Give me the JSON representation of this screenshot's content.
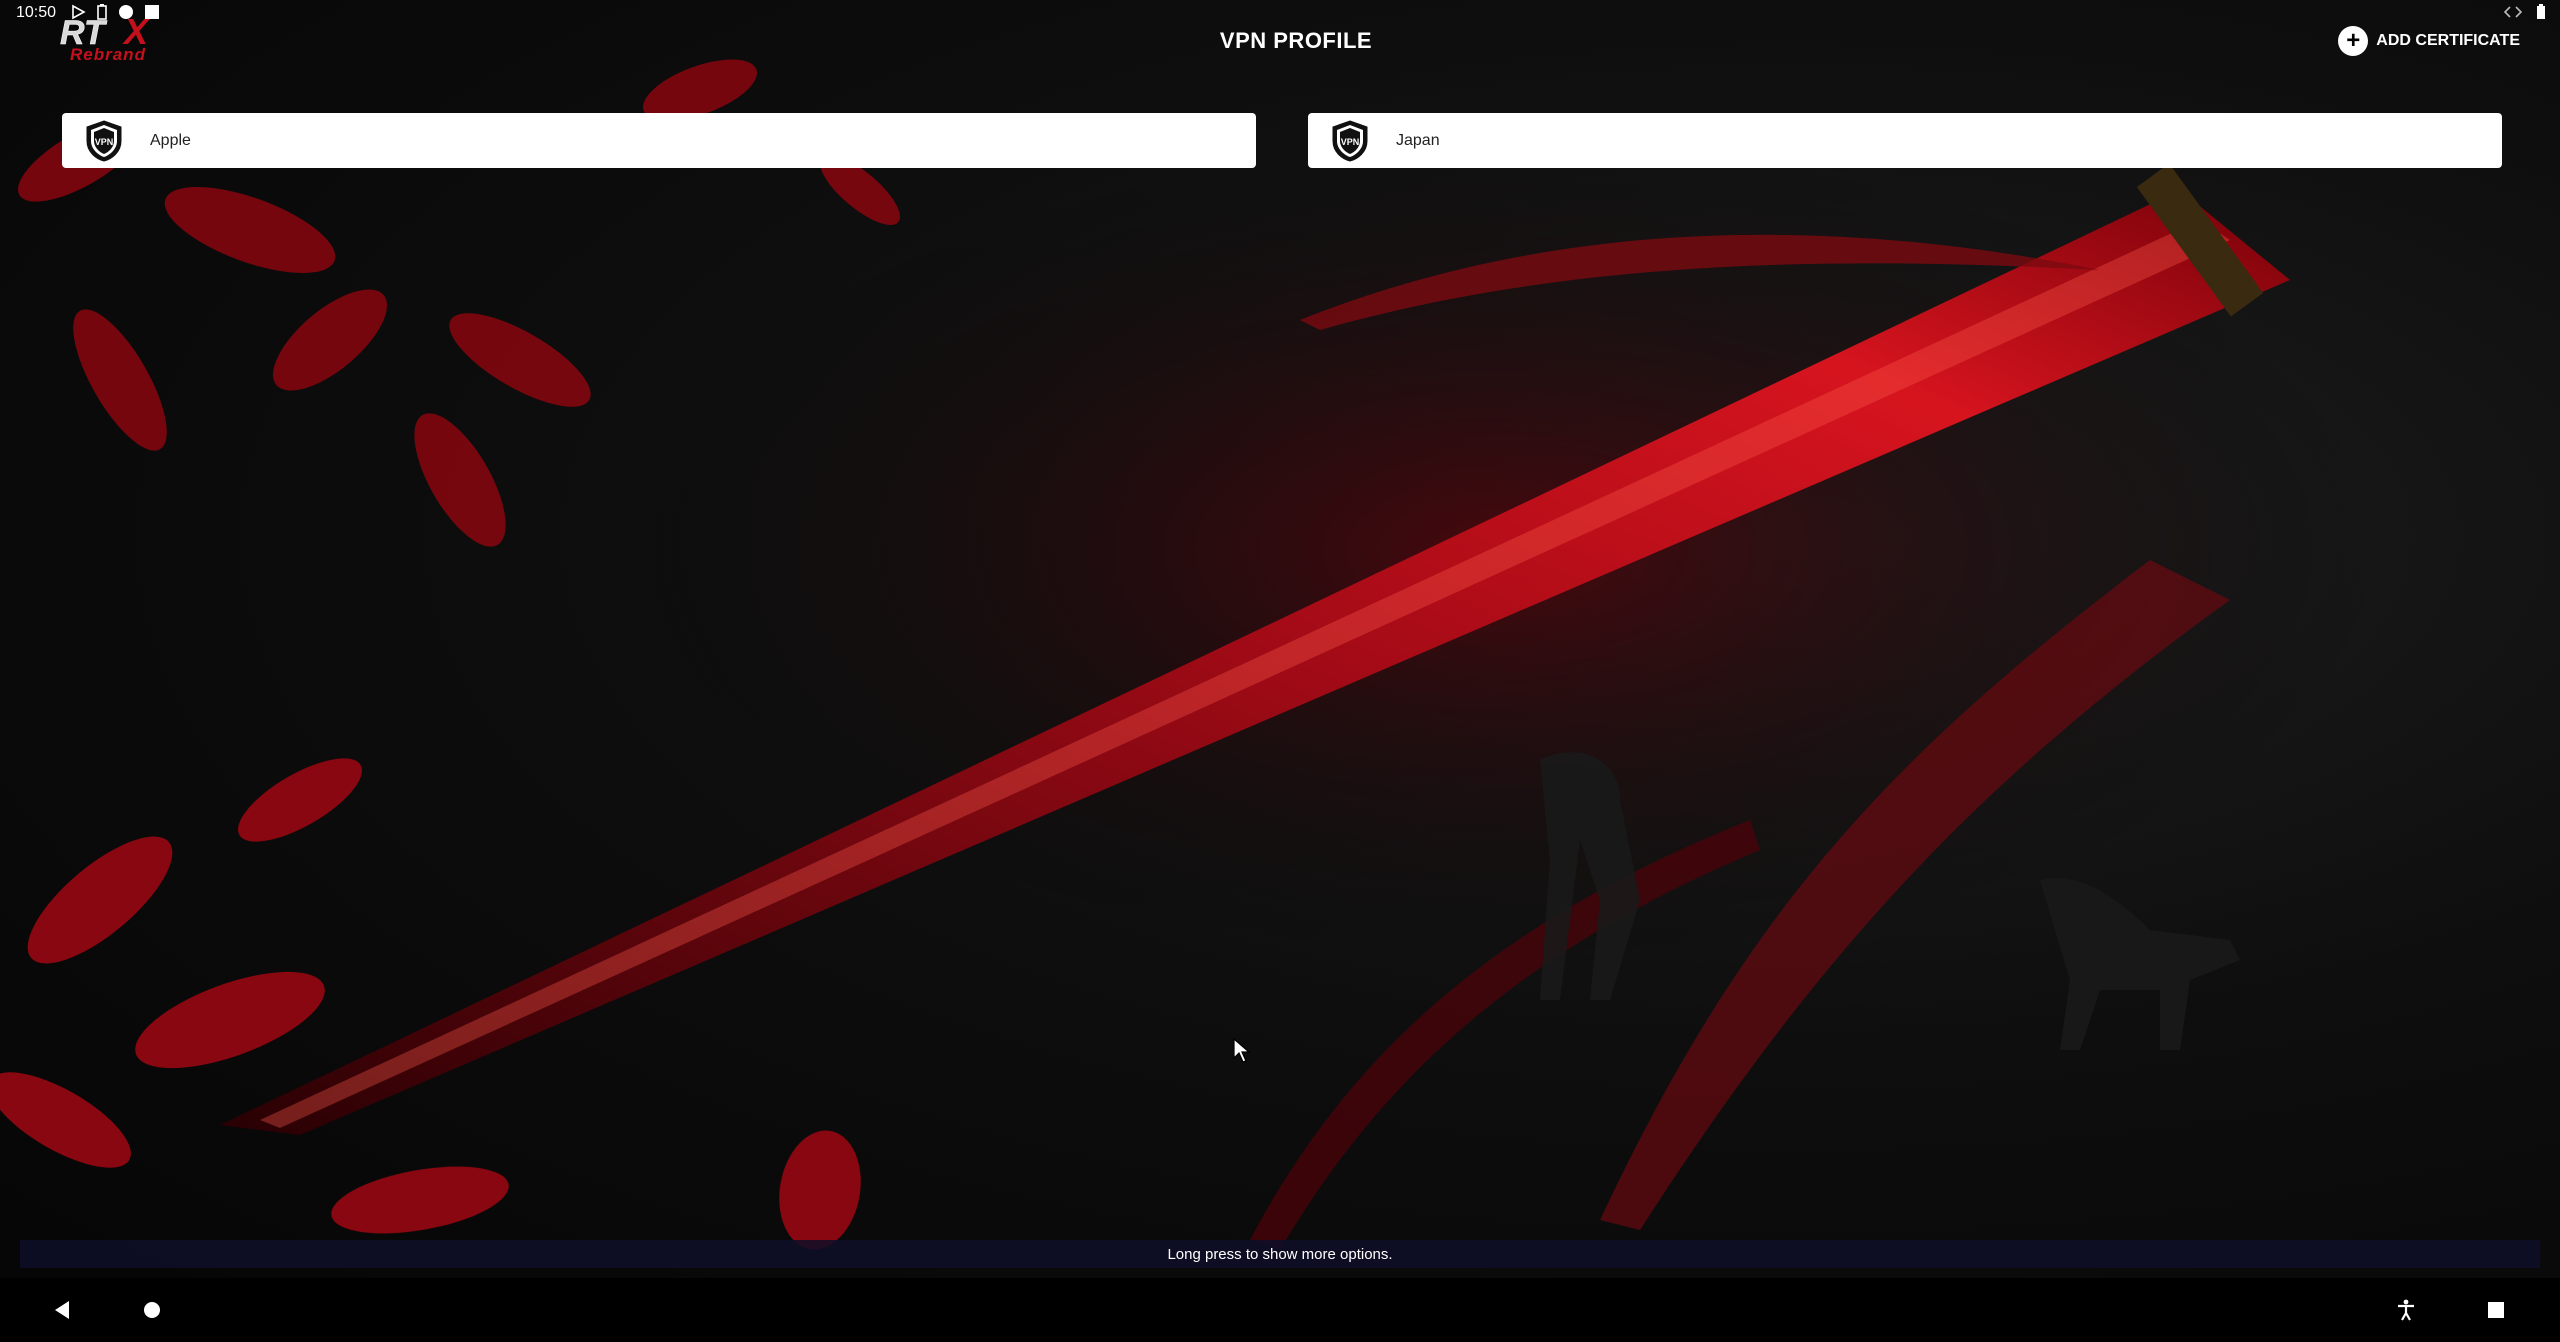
{
  "status_bar": {
    "time": "10:50",
    "left_icons": [
      "play-icon",
      "battery-saver-icon",
      "circle-icon",
      "square-icon"
    ],
    "right_icons": [
      "code-arrows-icon",
      "battery-icon"
    ]
  },
  "header": {
    "logo_top": "RTX",
    "logo_bottom": "Rebrand",
    "title": "VPN PROFILE",
    "add_certificate_label": "ADD CERTIFICATE"
  },
  "profiles": [
    {
      "name": "Apple",
      "icon": "vpn-shield-icon",
      "badge": "VPN"
    },
    {
      "name": "Japan",
      "icon": "vpn-shield-icon",
      "badge": "VPN"
    }
  ],
  "toast": {
    "message": "Long press to show more options."
  },
  "colors": {
    "accent_red": "#c4101c",
    "card_bg": "#ffffff",
    "toast_bg": "#0e0e28"
  }
}
